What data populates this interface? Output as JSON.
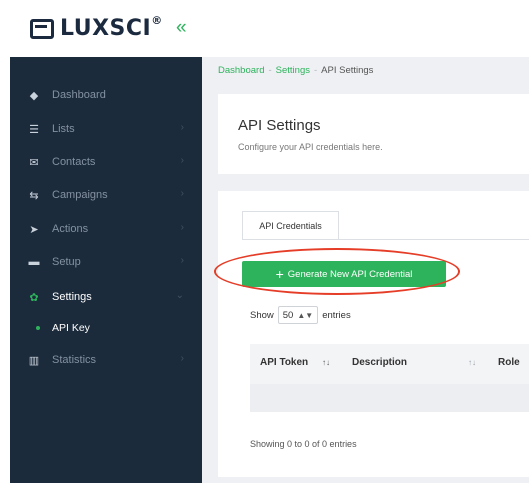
{
  "brand": {
    "name": "LUXSCI",
    "mark": "®",
    "collapse_icon": "«"
  },
  "sidebar": {
    "items": [
      {
        "label": "Dashboard",
        "icon": "diamond-icon",
        "glyph": "◆"
      },
      {
        "label": "Lists",
        "icon": "list-icon",
        "glyph": "☰"
      },
      {
        "label": "Contacts",
        "icon": "envelope-icon",
        "glyph": "✉"
      },
      {
        "label": "Campaigns",
        "icon": "arrows-icon",
        "glyph": "⇆"
      },
      {
        "label": "Actions",
        "icon": "send-icon",
        "glyph": "➤"
      },
      {
        "label": "Setup",
        "icon": "toggle-icon",
        "glyph": "▬"
      },
      {
        "label": "Settings",
        "icon": "gear-icon",
        "glyph": "✿"
      },
      {
        "label": "Statistics",
        "icon": "bar-chart-icon",
        "glyph": "▥"
      }
    ],
    "sub_item": "API Key",
    "chevron": "›",
    "chevron_down": "⌄"
  },
  "breadcrumb": {
    "items": [
      "Dashboard",
      "Settings",
      "API Settings"
    ],
    "sep": "-"
  },
  "page": {
    "title": "API Settings",
    "subtitle": "Configure your API credentials here."
  },
  "tabs": {
    "active": "API Credentials"
  },
  "actions": {
    "generate_label": "Generate New API Credential",
    "plus": "+"
  },
  "table": {
    "show_label": "Show",
    "page_size": "50",
    "entries_label": "entries",
    "columns": [
      "API Token",
      "Description",
      "Role"
    ],
    "sort_glyph": "↑↓",
    "footer": "Showing 0 to 0 of 0 entries"
  },
  "colors": {
    "accent": "#2db35b",
    "sidebar": "#1c2b3c",
    "highlight": "#e53d27"
  }
}
